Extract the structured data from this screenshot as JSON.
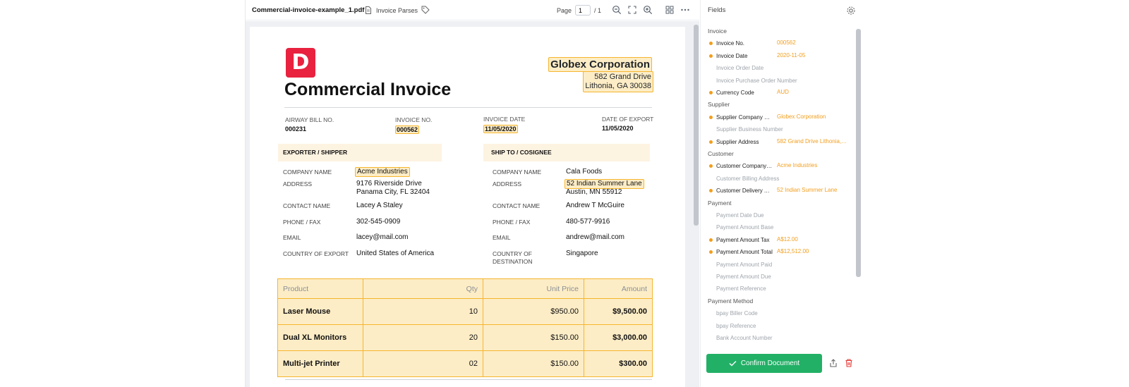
{
  "toolbar": {
    "file_name": "Commercial-invoice-example_1.pdf",
    "parses_label": "Invoice Parses",
    "page_label": "Page",
    "page_current": "1",
    "page_total": "/ 1"
  },
  "document": {
    "logo_letter": "D",
    "title": "Commercial Invoice",
    "supplier_name": "Globex Corporation",
    "supplier_addr1": "582 Grand Drive",
    "supplier_addr2": "Lithonia, GA 30038",
    "meta": [
      {
        "label": "AIRWAY BILL NO.",
        "value": "000231"
      },
      {
        "label": "INVOICE NO.",
        "value": "000562"
      },
      {
        "label": "INVOICE DATE",
        "value": "11/05/2020"
      },
      {
        "label": "DATE OF EXPORT",
        "value": "11/05/2020"
      }
    ],
    "exporter": {
      "title": "EXPORTER / SHIPPER",
      "company_label": "COMPANY NAME",
      "company": "Acme Industries",
      "address_label": "ADDRESS",
      "address1": "9176 Riverside Drive",
      "address2": "Panama City, FL 32404",
      "contact_label": "CONTACT NAME",
      "contact": "Lacey A Staley",
      "phone_label": "PHONE / FAX",
      "phone": "302-545-0909",
      "email_label": "EMAIL",
      "email": "lacey@mail.com",
      "country_label": "COUNTRY OF EXPORT",
      "country": "United States of America"
    },
    "consignee": {
      "title": "SHIP TO / COSIGNEE",
      "company_label": "COMPANY NAME",
      "company": "Cala Foods",
      "address_label": "ADDRESS",
      "address1": "52 Indian Summer Lane",
      "address2": "Austin, MN 55912",
      "contact_label": "CONTACT NAME",
      "contact": "Andrew T McGuire",
      "phone_label": "PHONE / FAX",
      "phone": "480-577-9916",
      "email_label": "EMAIL",
      "email": "andrew@mail.com",
      "country_label1": "COUNTRY OF",
      "country_label2": "DESTINATION",
      "country": "Singapore"
    },
    "items_header": {
      "product": "Product",
      "qty": "Qty",
      "unit_price": "Unit Price",
      "amount": "Amount"
    },
    "items": [
      {
        "product": "Laser Mouse",
        "qty": "10",
        "unit_price": "$950.00",
        "amount": "$9,500.00"
      },
      {
        "product": "Dual XL Monitors",
        "qty": "20",
        "unit_price": "$150.00",
        "amount": "$3,000.00"
      },
      {
        "product": "Multi-jet Printer",
        "qty": "02",
        "unit_price": "$150.00",
        "amount": "$300.00"
      }
    ]
  },
  "panel": {
    "title": "Fields",
    "confirm_label": "Confirm Document",
    "accent_color": "#f29e1d",
    "confirm_color": "#22b066",
    "rows": [
      {
        "type": "group",
        "label": "Invoice"
      },
      {
        "type": "field",
        "label": "Invoice No.",
        "value": "000562"
      },
      {
        "type": "field",
        "label": "Invoice Date",
        "value": "2020-11-05"
      },
      {
        "type": "empty",
        "label": "Invoice Order Date"
      },
      {
        "type": "empty",
        "label": "Invoice Purchase Order Number"
      },
      {
        "type": "field",
        "label": "Currency Code",
        "value": "AUD"
      },
      {
        "type": "group",
        "label": "Supplier"
      },
      {
        "type": "field",
        "label": "Supplier Company Na...",
        "value": "Globex Corporation"
      },
      {
        "type": "empty",
        "label": "Supplier Business Number"
      },
      {
        "type": "field",
        "label": "Supplier Address",
        "value": "582 Grand Drive Lithonia, ..."
      },
      {
        "type": "group",
        "label": "Customer"
      },
      {
        "type": "field",
        "label": "Customer Company N...",
        "value": "Acme Industries"
      },
      {
        "type": "empty",
        "label": "Customer Billing Address"
      },
      {
        "type": "field",
        "label": "Customer Delivery Ad...",
        "value": "52 Indian Summer Lane"
      },
      {
        "type": "group",
        "label": "Payment"
      },
      {
        "type": "empty",
        "label": "Payment Date Due"
      },
      {
        "type": "empty",
        "label": "Payment Amount Base"
      },
      {
        "type": "field",
        "label": "Payment Amount Tax",
        "value": "A$12.00"
      },
      {
        "type": "field",
        "label": "Payment Amount Total",
        "value": "A$12,512.00"
      },
      {
        "type": "empty",
        "label": "Payment Amount Paid"
      },
      {
        "type": "empty",
        "label": "Payment Amount Due"
      },
      {
        "type": "empty",
        "label": "Payment Reference"
      },
      {
        "type": "group",
        "label": "Payment Method"
      },
      {
        "type": "empty",
        "label": "bpay Biller Code"
      },
      {
        "type": "empty",
        "label": "bpay Reference"
      },
      {
        "type": "empty",
        "label": "Bank Account Number"
      }
    ]
  }
}
